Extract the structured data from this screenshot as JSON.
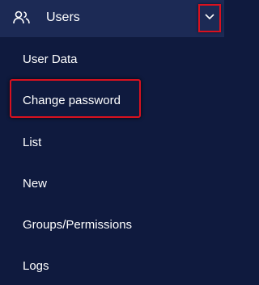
{
  "header": {
    "title": "Users",
    "icon": "users-icon",
    "toggle_icon": "chevron-down-icon"
  },
  "menu": {
    "items": [
      {
        "label": "User Data"
      },
      {
        "label": "Change password",
        "highlighted": true
      },
      {
        "label": "List"
      },
      {
        "label": "New"
      },
      {
        "label": "Groups/Permissions"
      },
      {
        "label": "Logs"
      }
    ]
  },
  "colors": {
    "background": "#0f1a3e",
    "header_background": "#1c2a55",
    "highlight_border": "#d9111f",
    "text": "#ffffff"
  }
}
